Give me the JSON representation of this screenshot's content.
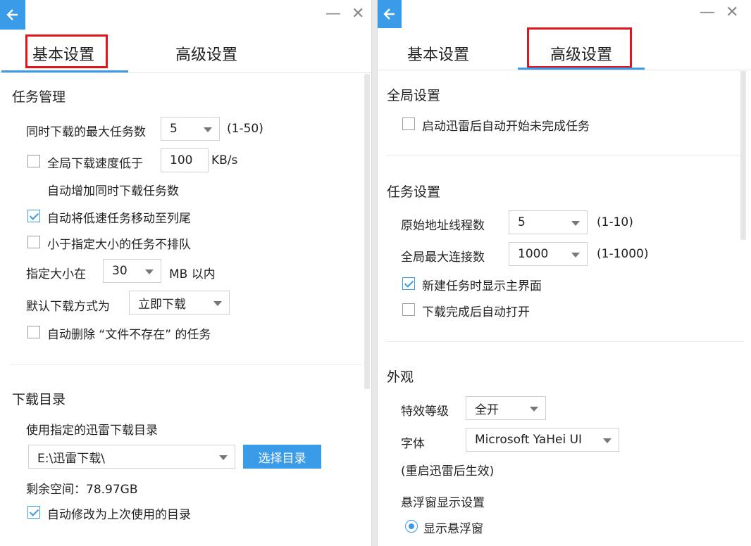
{
  "colors": {
    "accent": "#3a9be8",
    "highlight_box": "#e0161c"
  },
  "left": {
    "tabs": [
      {
        "label": "基本设置",
        "active": true
      },
      {
        "label": "高级设置",
        "active": false
      }
    ],
    "window_controls": {
      "minimize": "—",
      "close": "✕"
    },
    "task_mgmt": {
      "title": "任务管理",
      "max_tasks_label": "同时下载的最大任务数",
      "max_tasks_value": "5",
      "max_tasks_range": "(1-50)",
      "speed_low_label": "全局下载速度低于",
      "speed_low_checked": false,
      "speed_value": "100",
      "speed_unit": "KB/s",
      "speed_low_label2": "自动增加同时下载任务数",
      "move_slow_label": "自动将低速任务移动至列尾",
      "move_slow_checked": true,
      "small_no_queue_label": "小于指定大小的任务不排队",
      "small_no_queue_checked": false,
      "size_label": "指定大小在",
      "size_value": "30",
      "size_unit": "MB 以内",
      "download_mode_label": "默认下载方式为",
      "download_mode_value": "立即下载",
      "auto_delete_label": "自动删除 “文件不存在” 的任务",
      "auto_delete_checked": false
    },
    "download_dir": {
      "title": "下载目录",
      "use_dir_label": "使用指定的迅雷下载目录",
      "dir_value": "E:\\迅雷下载\\",
      "choose_button": "选择目录",
      "free_space": "剩余空间：78.97GB",
      "auto_last_dir_label": "自动修改为上次使用的目录",
      "auto_last_dir_checked": true
    }
  },
  "right": {
    "tabs": [
      {
        "label": "基本设置",
        "active": false
      },
      {
        "label": "高级设置",
        "active": true
      }
    ],
    "window_controls": {
      "minimize": "—",
      "close": "✕"
    },
    "global": {
      "title": "全局设置",
      "auto_start_label": "启动迅雷后自动开始未完成任务",
      "auto_start_checked": false
    },
    "task": {
      "title": "任务设置",
      "threads_label": "原始地址线程数",
      "threads_value": "5",
      "threads_range": "(1-10)",
      "max_conn_label": "全局最大连接数",
      "max_conn_value": "1000",
      "max_conn_range": "(1-1000)",
      "show_main_label": "新建任务时显示主界面",
      "show_main_checked": true,
      "auto_open_label": "下载完成后自动打开",
      "auto_open_checked": false
    },
    "appearance": {
      "title": "外观",
      "effect_label": "特效等级",
      "effect_value": "全开",
      "font_label": "字体",
      "font_value": "Microsoft YaHei UI",
      "restart_note": "(重启迅雷后生效)",
      "float_title": "悬浮窗显示设置",
      "show_float_label": "显示悬浮窗",
      "show_float_selected": true
    }
  }
}
